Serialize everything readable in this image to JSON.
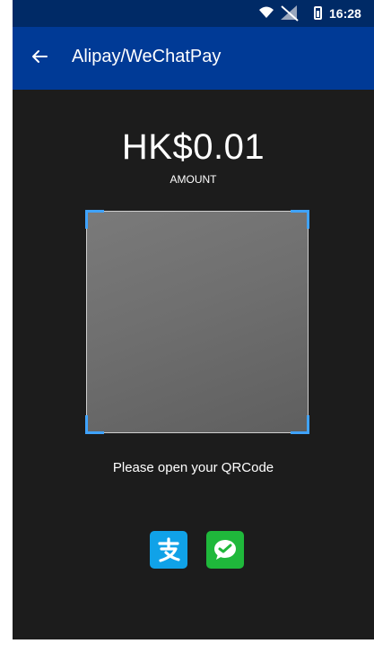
{
  "status_bar": {
    "time": "16:28",
    "icons": [
      "wifi-icon",
      "signal-icon",
      "battery-icon"
    ]
  },
  "header": {
    "back_icon": "arrow-left-icon",
    "title": "Alipay/WeChatPay"
  },
  "payment": {
    "amount": "HK$0.01",
    "amount_label": "AMOUNT",
    "instruction": "Please open your QRCode"
  },
  "payment_methods": [
    {
      "icon": "alipay-icon",
      "color": "#10a2e8"
    },
    {
      "icon": "wechat-pay-icon",
      "color": "#1fb83b"
    }
  ],
  "colors": {
    "status_bar": "#002a66",
    "app_bar": "#003a96",
    "background": "#1c1c1c",
    "scan_corner": "#3fa3ff"
  }
}
